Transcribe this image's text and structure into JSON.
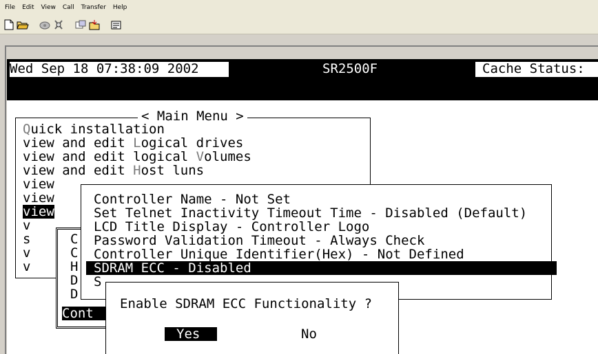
{
  "menubar": [
    "File",
    "Edit",
    "View",
    "Call",
    "Transfer",
    "Help"
  ],
  "toolbar_icons": [
    "new-icon",
    "open-icon",
    "connect-icon",
    "disconnect-icon",
    "send-icon",
    "receive-icon",
    "properties-icon"
  ],
  "terminal": {
    "status": {
      "datetime": "Wed Sep 18 07:38:09 2002",
      "model": "SR2500F",
      "cache_label": "Cache Status:"
    },
    "main_menu": {
      "title": "< Main Menu >",
      "items": [
        {
          "hotkey": "Q",
          "rest": "uick installation",
          "prefix": ""
        },
        {
          "prefix": "view and edit ",
          "hotkey": "L",
          "rest": "ogical drives"
        },
        {
          "prefix": "view and edit logical ",
          "hotkey": "V",
          "rest": "olumes"
        },
        {
          "prefix": "view and edit ",
          "hotkey": "H",
          "rest": "ost luns"
        }
      ],
      "partial_rows": [
        "view",
        "view",
        "view",
        "v",
        "s",
        "v",
        "v"
      ]
    },
    "submenu_letters": [
      "C",
      "C",
      "H",
      "D",
      "D"
    ],
    "submenu_selected": "Cont",
    "config_menu": {
      "items": [
        "Controller Name - Not Set",
        "Set Telnet Inactivity Timeout Time - Disabled (Default)",
        "LCD Title Display - Controller Logo",
        "Password Validation Timeout - Always Check",
        "Controller Unique Identifier(Hex) - Not Defined",
        "SDRAM ECC - Disabled",
        "S"
      ],
      "selected_index": 5
    },
    "dialog": {
      "question": "Enable SDRAM ECC Functionality ?",
      "yes": "Yes",
      "no": "No"
    }
  }
}
